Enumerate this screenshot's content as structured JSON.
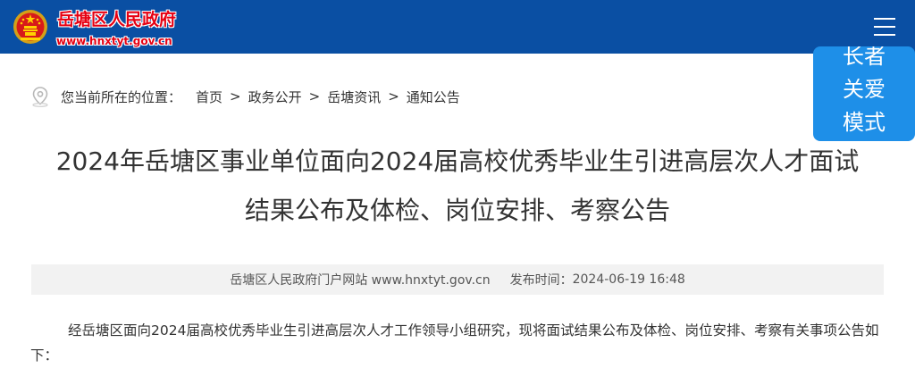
{
  "header": {
    "site_name": "岳塘区人民政府",
    "site_url": "www.hnxtyt.gov.cn",
    "logo_icon": "national-emblem-icon",
    "menu_icon": "hamburger-menu-icon",
    "background_color": "#0a4fa3",
    "brand_text_color": "#e60012"
  },
  "elder_mode": {
    "lines": [
      "长者",
      "关爱",
      "模式"
    ],
    "background_color": "#1e8fe8"
  },
  "breadcrumb": {
    "icon": "location-pin-icon",
    "prefix": "您当前所在的位置：",
    "items": [
      "首页",
      "政务公开",
      "岳塘资讯",
      "通知公告"
    ],
    "separator": ">"
  },
  "article": {
    "title_lines": [
      "2024年岳塘区事业单位面向2024届高校优秀毕业生引进高层次人才面试",
      "结果公布及体检、岗位安排、考察公告"
    ],
    "source": "岳塘区人民政府门户网站 www.hnxtyt.gov.cn",
    "publish_label": "发布时间：",
    "publish_time": "2024-06-19 16:48",
    "first_paragraph": "经岳塘区面向2024届高校优秀毕业生引进高层次人才工作领导小组研究，现将面试结果公布及体检、岗位安排、考察有关事项公告如下："
  }
}
